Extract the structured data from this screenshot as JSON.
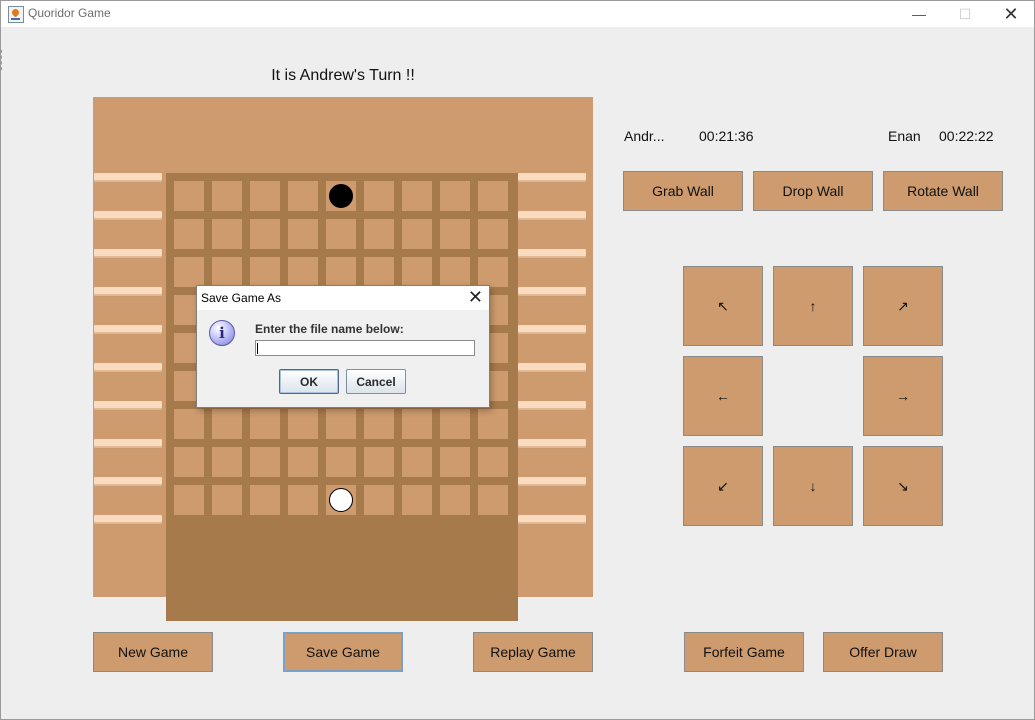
{
  "window": {
    "title": "Quoridor Game",
    "minimize_glyph": "—",
    "maximize_glyph": "☐",
    "close_glyph": "✕"
  },
  "turn_text": "It is Andrew's Turn !!",
  "players": [
    {
      "name": "Andr...",
      "time": "00:21:36"
    },
    {
      "name": "Enan",
      "time": "00:22:22"
    }
  ],
  "wall_controls": {
    "grab": "Grab Wall",
    "drop": "Drop Wall",
    "rotate": "Rotate Wall"
  },
  "move_pad": {
    "up_left": "↖",
    "up": "↑",
    "up_right": "↗",
    "left": "←",
    "right": "→",
    "down_left": "↙",
    "down": "↓",
    "down_right": "↘"
  },
  "bottom_buttons": {
    "new_game": "New Game",
    "save_game": "Save Game",
    "replay_game": "Replay Game",
    "forfeit_game": "Forfeit Game",
    "offer_draw": "Offer Draw"
  },
  "board": {
    "rows": 9,
    "cols": 9,
    "walls_in_stock_per_side": 10,
    "pawns": [
      {
        "player": "Andrew",
        "color": "black",
        "row": 1,
        "col": 5
      },
      {
        "player": "Enan",
        "color": "white",
        "row": 9,
        "col": 5
      }
    ]
  },
  "dialog": {
    "title": "Save Game As",
    "close_glyph": "✕",
    "icon": "info-icon",
    "prompt": "Enter the file name below:",
    "input_value": "",
    "ok": "OK",
    "cancel": "Cancel"
  },
  "colors": {
    "board": "#cd9b6d",
    "grooves": "#a77a4b",
    "wall": "#f9dcc0",
    "background": "#eeeeee"
  }
}
